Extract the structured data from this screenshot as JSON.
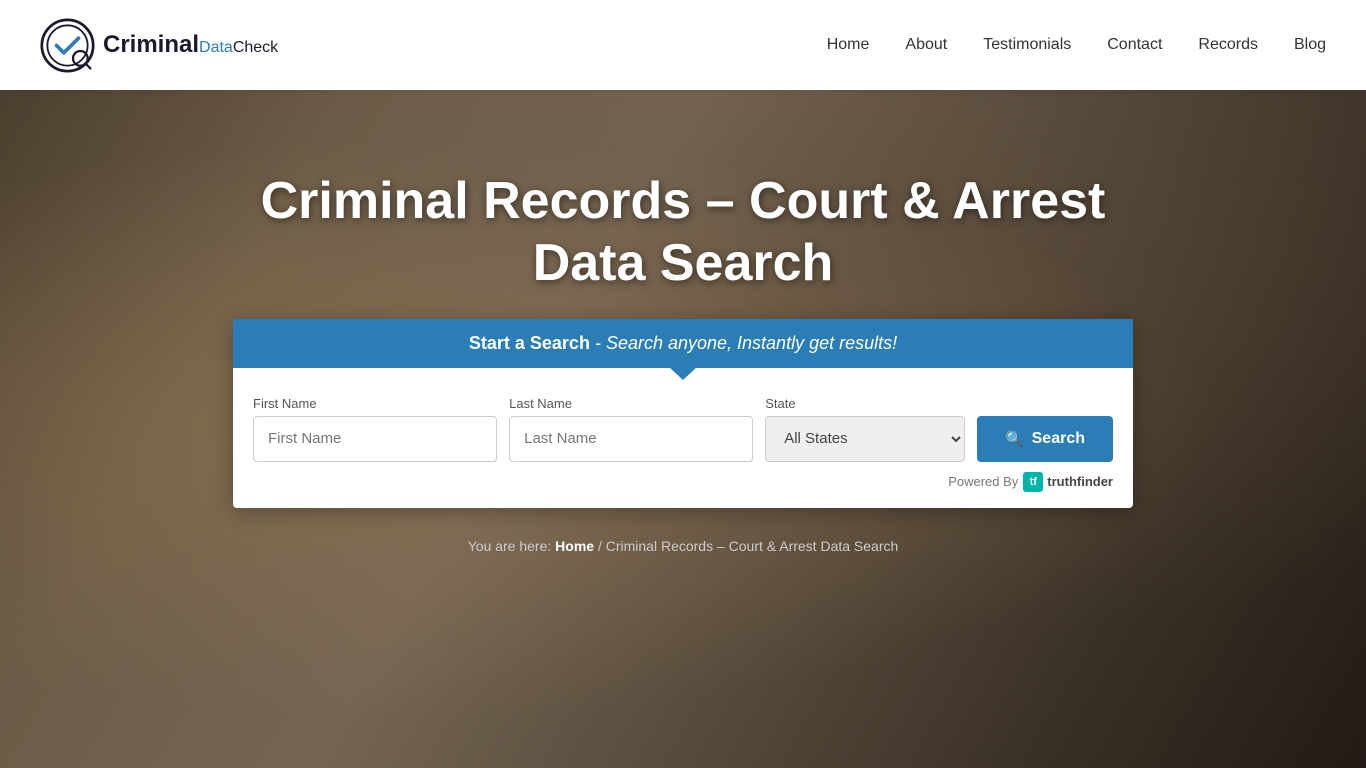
{
  "header": {
    "logo_text_criminal": "Criminal",
    "logo_text_data": "Data",
    "logo_text_check": "Check",
    "nav": {
      "home": "Home",
      "about": "About",
      "testimonials": "Testimonials",
      "contact": "Contact",
      "records": "Records",
      "blog": "Blog"
    }
  },
  "hero": {
    "title_line1": "Criminal Records – Court & Arrest",
    "title_line2": "Data Search",
    "search_header_bold": "Start a Search",
    "search_header_italic": "- Search anyone, Instantly get results!",
    "fields": {
      "first_name_label": "First Name",
      "first_name_placeholder": "First Name",
      "last_name_label": "Last Name",
      "last_name_placeholder": "Last Name",
      "state_label": "State",
      "state_default": "All States"
    },
    "search_button": "Search",
    "powered_by": "Powered By",
    "truthfinder": "truthfinder",
    "tf_icon_text": "tf"
  },
  "breadcrumb": {
    "prefix": "You are here: ",
    "home_link": "Home",
    "separator": " / ",
    "current": "Criminal Records – Court & Arrest Data Search"
  }
}
